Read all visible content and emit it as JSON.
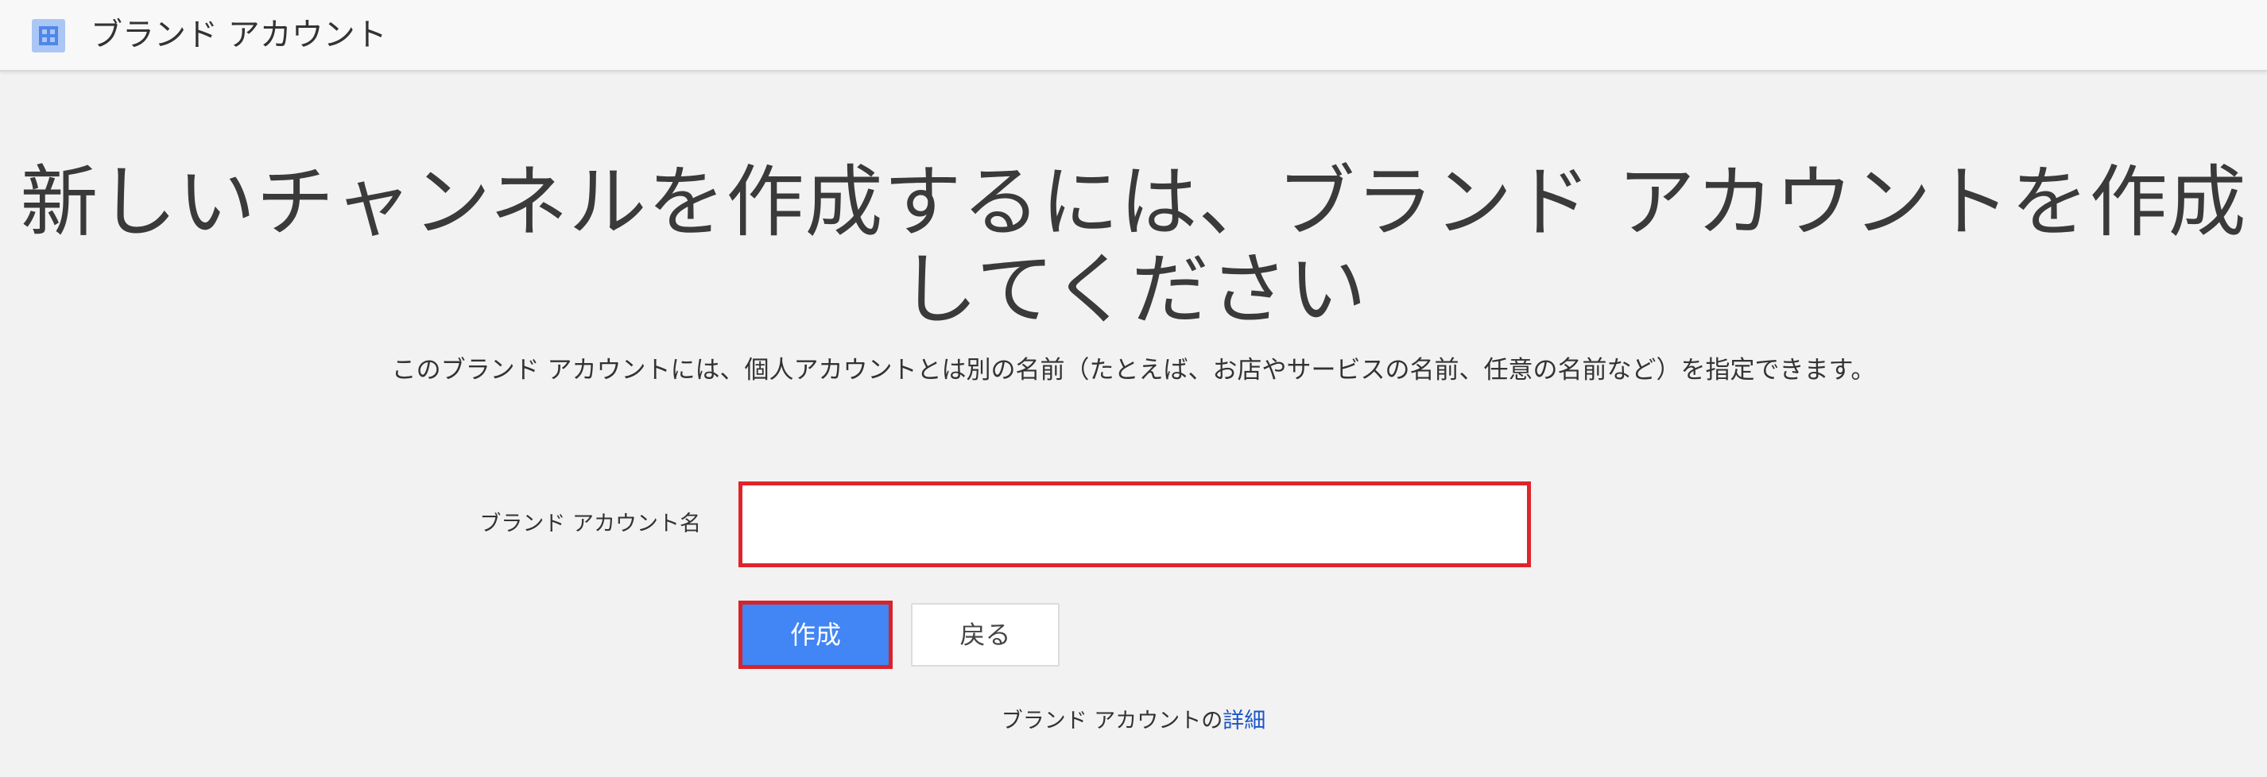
{
  "header": {
    "logo_icon": "brand-account-icon",
    "title": "ブランド アカウント"
  },
  "main": {
    "headline_line1": "新しいチャンネルを作成するには、ブランド アカウントを作成",
    "headline_line2": "してください",
    "description": "このブランド アカウントには、個人アカウントとは別の名前（たとえば、お店やサービスの名前、任意の名前など）を指定できます。",
    "form": {
      "name_label": "ブランド アカウント名",
      "name_value": "",
      "name_placeholder": ""
    },
    "buttons": {
      "create_label": "作成",
      "back_label": "戻る"
    },
    "footer": {
      "prefix": "ブランド アカウントの",
      "link_label": "詳細"
    }
  },
  "colors": {
    "primary_button": "#4285f4",
    "highlight_border": "#e0242b",
    "link": "#1a55c9",
    "background": "#f2f2f2"
  }
}
